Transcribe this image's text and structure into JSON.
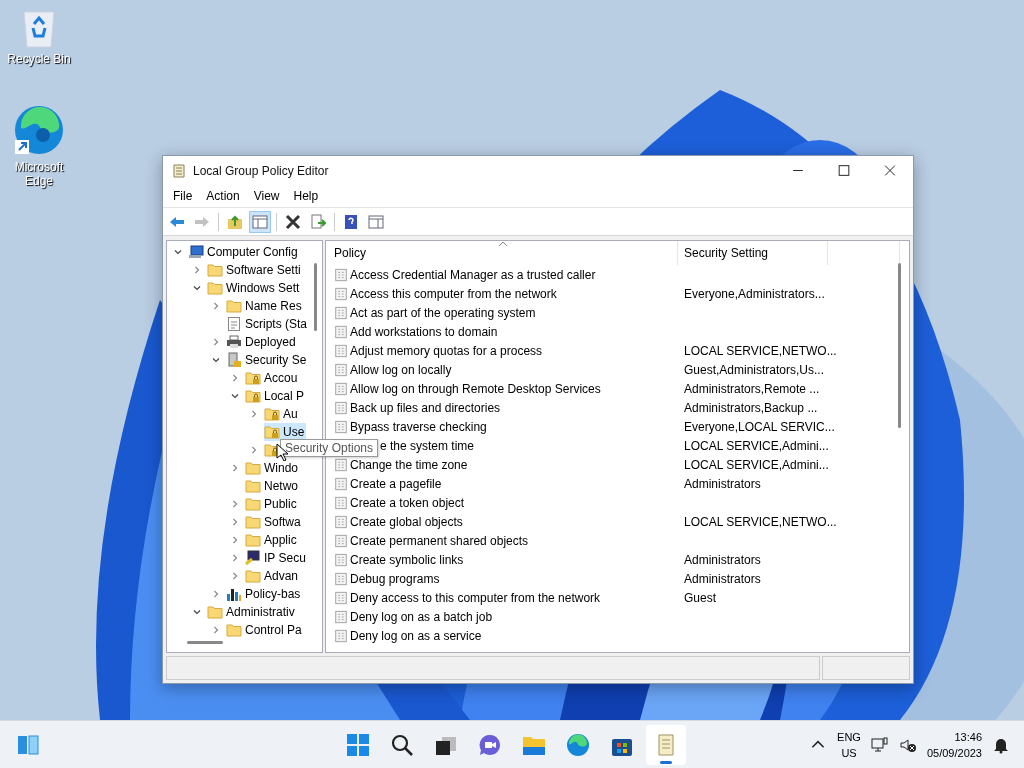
{
  "desktop_icons": [
    {
      "kind": "recycle",
      "label": "Recycle Bin"
    },
    {
      "kind": "edge",
      "label": "Microsoft Edge"
    }
  ],
  "window": {
    "title": "Local Group Policy Editor",
    "menu": [
      "File",
      "Action",
      "View",
      "Help"
    ],
    "toolbar": [
      {
        "kind": "back",
        "disabled": false,
        "pressed": false
      },
      {
        "kind": "forward",
        "disabled": true,
        "pressed": false
      },
      {
        "kind": "separator"
      },
      {
        "kind": "up",
        "disabled": false,
        "pressed": false
      },
      {
        "kind": "tree",
        "disabled": false,
        "pressed": true
      },
      {
        "kind": "separator"
      },
      {
        "kind": "delete",
        "disabled": false,
        "pressed": false
      },
      {
        "kind": "export",
        "disabled": false,
        "pressed": false
      },
      {
        "kind": "separator"
      },
      {
        "kind": "help",
        "disabled": false,
        "pressed": false
      },
      {
        "kind": "panel",
        "disabled": false,
        "pressed": false
      }
    ]
  },
  "tree": [
    {
      "label": "Computer Config",
      "kind": "computer",
      "expandable": true,
      "expanded": true,
      "selected": false,
      "children": [
        {
          "label": "Software Setti",
          "kind": "folder",
          "expandable": true,
          "expanded": false,
          "selected": false
        },
        {
          "label": "Windows Sett",
          "kind": "folder",
          "expandable": true,
          "expanded": true,
          "selected": false,
          "children": [
            {
              "label": "Name Res",
              "kind": "folder",
              "expandable": true,
              "expanded": false,
              "selected": false
            },
            {
              "label": "Scripts (Sta",
              "kind": "script",
              "selected": false
            },
            {
              "label": "Deployed",
              "kind": "printer",
              "expandable": true,
              "expanded": false,
              "selected": false
            },
            {
              "label": "Security Se",
              "kind": "security",
              "expandable": true,
              "expanded": true,
              "selected": false,
              "children": [
                {
                  "label": "Accou",
                  "kind": "lockfolder",
                  "expandable": true,
                  "expanded": false,
                  "selected": false
                },
                {
                  "label": "Local P",
                  "kind": "lockfolder",
                  "expandable": true,
                  "expanded": true,
                  "selected": false,
                  "children": [
                    {
                      "label": "Au",
                      "kind": "lockfolder",
                      "expandable": true,
                      "expanded": false,
                      "selected": false
                    },
                    {
                      "label": "Use",
                      "kind": "lockfolder",
                      "selected": true
                    },
                    {
                      "kind": "lockfolder",
                      "expandable": true,
                      "expanded": false,
                      "selected": false
                    }
                  ]
                },
                {
                  "label": "Windo",
                  "kind": "folder",
                  "expandable": true,
                  "expanded": false,
                  "selected": false
                },
                {
                  "label": "Netwo",
                  "kind": "folder",
                  "selected": false
                },
                {
                  "label": "Public",
                  "kind": "folder",
                  "expandable": true,
                  "expanded": false,
                  "selected": false
                },
                {
                  "label": "Softwa",
                  "kind": "folder",
                  "expandable": true,
                  "expanded": false,
                  "selected": false
                },
                {
                  "label": "Applic",
                  "kind": "folder",
                  "expandable": true,
                  "expanded": false,
                  "selected": false
                },
                {
                  "label": "IP Secu",
                  "kind": "ipsec",
                  "expandable": true,
                  "expanded": false,
                  "selected": false
                },
                {
                  "label": "Advan",
                  "kind": "folder",
                  "expandable": true,
                  "expanded": false,
                  "selected": false
                }
              ]
            },
            {
              "label": "Policy-bas",
              "kind": "chart",
              "expandable": true,
              "expanded": false,
              "selected": false
            }
          ]
        },
        {
          "label": "Administrativ",
          "kind": "folder",
          "expandable": true,
          "expanded": true,
          "selected": false,
          "children": [
            {
              "label": "Control Pa",
              "kind": "folder",
              "expandable": true,
              "expanded": false,
              "selected": false
            }
          ]
        }
      ]
    }
  ],
  "tooltip": "Security Options",
  "table": {
    "columns": [
      "Policy",
      "Security Setting"
    ],
    "rows": [
      {
        "policy": "Access Credential Manager as a trusted caller",
        "setting": "",
        "covered": false
      },
      {
        "policy": "Access this computer from the network",
        "setting": "Everyone,Administrators...",
        "covered": false
      },
      {
        "policy": "Act as part of the operating system",
        "setting": "",
        "covered": false
      },
      {
        "policy": "Add workstations to domain",
        "setting": "",
        "covered": false
      },
      {
        "policy": "Adjust memory quotas for a process",
        "setting": "LOCAL SERVICE,NETWO...",
        "covered": false
      },
      {
        "policy": "Allow log on locally",
        "setting": "Guest,Administrators,Us...",
        "covered": false
      },
      {
        "policy": "Allow log on through Remote Desktop Services",
        "setting": "Administrators,Remote ...",
        "covered": false
      },
      {
        "policy": "Back up files and directories",
        "setting": "Administrators,Backup ...",
        "covered": false
      },
      {
        "policy": "Bypass traverse checking",
        "setting": "Everyone,LOCAL SERVIC...",
        "covered": false
      },
      {
        "policy": "e the system time",
        "setting": "LOCAL SERVICE,Admini...",
        "covered": true
      },
      {
        "policy": "Change the time zone",
        "setting": "LOCAL SERVICE,Admini...",
        "covered": false
      },
      {
        "policy": "Create a pagefile",
        "setting": "Administrators",
        "covered": false
      },
      {
        "policy": "Create a token object",
        "setting": "",
        "covered": false
      },
      {
        "policy": "Create global objects",
        "setting": "LOCAL SERVICE,NETWO...",
        "covered": false
      },
      {
        "policy": "Create permanent shared objects",
        "setting": "",
        "covered": false
      },
      {
        "policy": "Create symbolic links",
        "setting": "Administrators",
        "covered": false
      },
      {
        "policy": "Debug programs",
        "setting": "Administrators",
        "covered": false
      },
      {
        "policy": "Deny access to this computer from the network",
        "setting": "Guest",
        "covered": false
      },
      {
        "policy": "Deny log on as a batch job",
        "setting": "",
        "covered": false
      },
      {
        "policy": "Deny log on as a service",
        "setting": "",
        "covered": false
      }
    ]
  },
  "taskbar": {
    "apps": [
      {
        "kind": "start",
        "selected": false
      },
      {
        "kind": "search",
        "selected": false
      },
      {
        "kind": "taskview",
        "selected": false
      },
      {
        "kind": "chat",
        "selected": false
      },
      {
        "kind": "explorer",
        "selected": false
      },
      {
        "kind": "edge",
        "selected": false
      },
      {
        "kind": "store",
        "selected": false
      },
      {
        "kind": "policy",
        "selected": true
      }
    ],
    "language": "ENG",
    "region": "US",
    "time": "13:46",
    "date": "05/09/2023"
  }
}
